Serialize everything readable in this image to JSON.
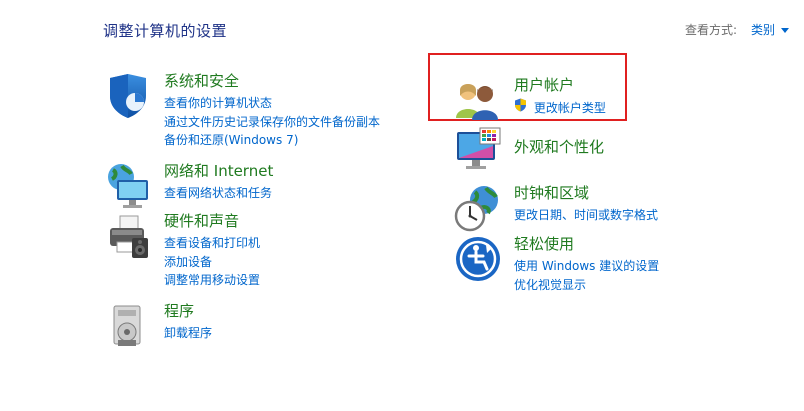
{
  "header": {
    "title": "调整计算机的设置"
  },
  "view_by": {
    "label": "查看方式:",
    "value": "类别"
  },
  "left_categories": [
    {
      "title": "系统和安全",
      "icon": "shield-icon",
      "links": [
        "查看你的计算机状态",
        "通过文件历史记录保存你的文件备份副本",
        "备份和还原(Windows 7)"
      ]
    },
    {
      "title": "网络和 Internet",
      "icon": "network-icon",
      "links": [
        "查看网络状态和任务"
      ]
    },
    {
      "title": "硬件和声音",
      "icon": "printer-icon",
      "links": [
        "查看设备和打印机",
        "添加设备",
        "调整常用移动设置"
      ]
    },
    {
      "title": "程序",
      "icon": "programs-icon",
      "links": [
        "卸载程序"
      ]
    }
  ],
  "right_categories": [
    {
      "title": "用户帐户",
      "icon": "users-icon",
      "links": [
        "更改帐户类型"
      ],
      "highlighted": true
    },
    {
      "title": "外观和个性化",
      "icon": "monitor-icon",
      "links": []
    },
    {
      "title": "时钟和区域",
      "icon": "clock-globe-icon",
      "links": [
        "更改日期、时间或数字格式"
      ]
    },
    {
      "title": "轻松使用",
      "icon": "ease-of-access-icon",
      "links": [
        "使用 Windows 建议的设置",
        "优化视觉显示"
      ]
    }
  ],
  "colors": {
    "title_blue": "#1e3287",
    "category_green": "#1f7a1f",
    "link_blue": "#0066cc",
    "highlight_red": "#e02020"
  }
}
